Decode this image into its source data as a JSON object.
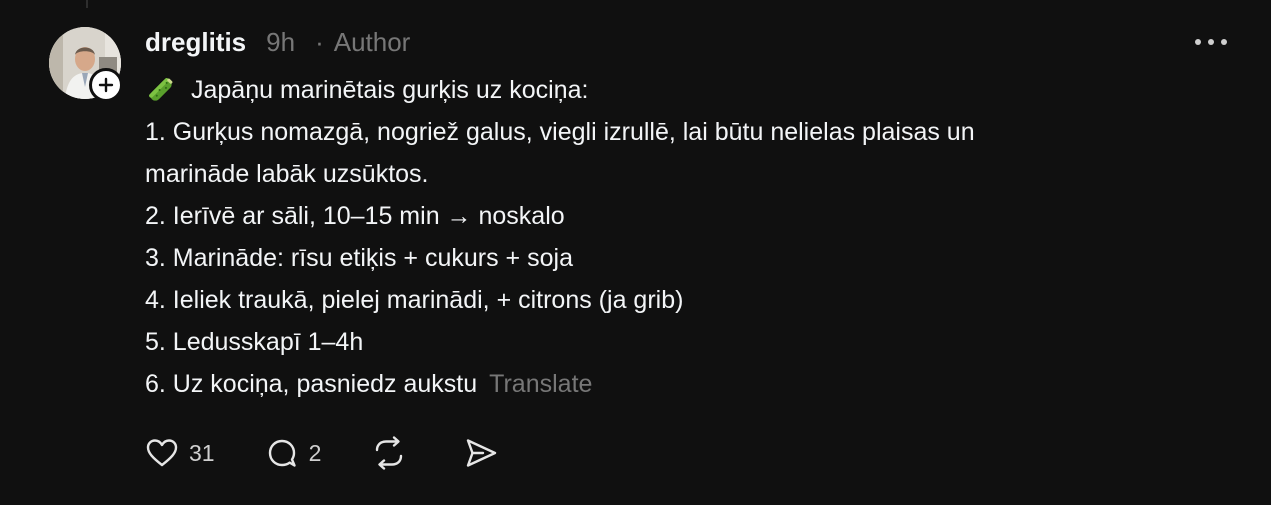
{
  "post": {
    "username": "dreglitis",
    "time": "9h",
    "separator": "·",
    "author_badge": "Author",
    "intro": "Japāņu marinētais gurķis uz kociņa:",
    "intro_emoji": "cucumber",
    "steps": [
      "1. Gurķus nomazgā, nogriež galus, viegli izrullē, lai būtu nelielas plaisas un",
      "marināde labāk uzsūktos.",
      "2. Ierīvē ar sāli, 10–15 min → noskalo",
      "3. Marināde: rīsu etiķis + cukurs + soja",
      "4. Ieliek traukā, pielej marinādi, + citrons (ja grib)",
      "5. Ledusskapī 1–4h",
      "6. Uz kociņa, pasniedz aukstu"
    ],
    "translate_label": "Translate",
    "likes": "31",
    "replies": "2"
  },
  "icons": {
    "more": "more-horizontal-icon",
    "like": "heart-icon",
    "reply": "comment-icon",
    "repost": "repost-icon",
    "share": "send-icon",
    "follow": "plus-icon"
  },
  "colors": {
    "background": "#101010",
    "text": "#f3f5f7",
    "muted": "#777777"
  }
}
